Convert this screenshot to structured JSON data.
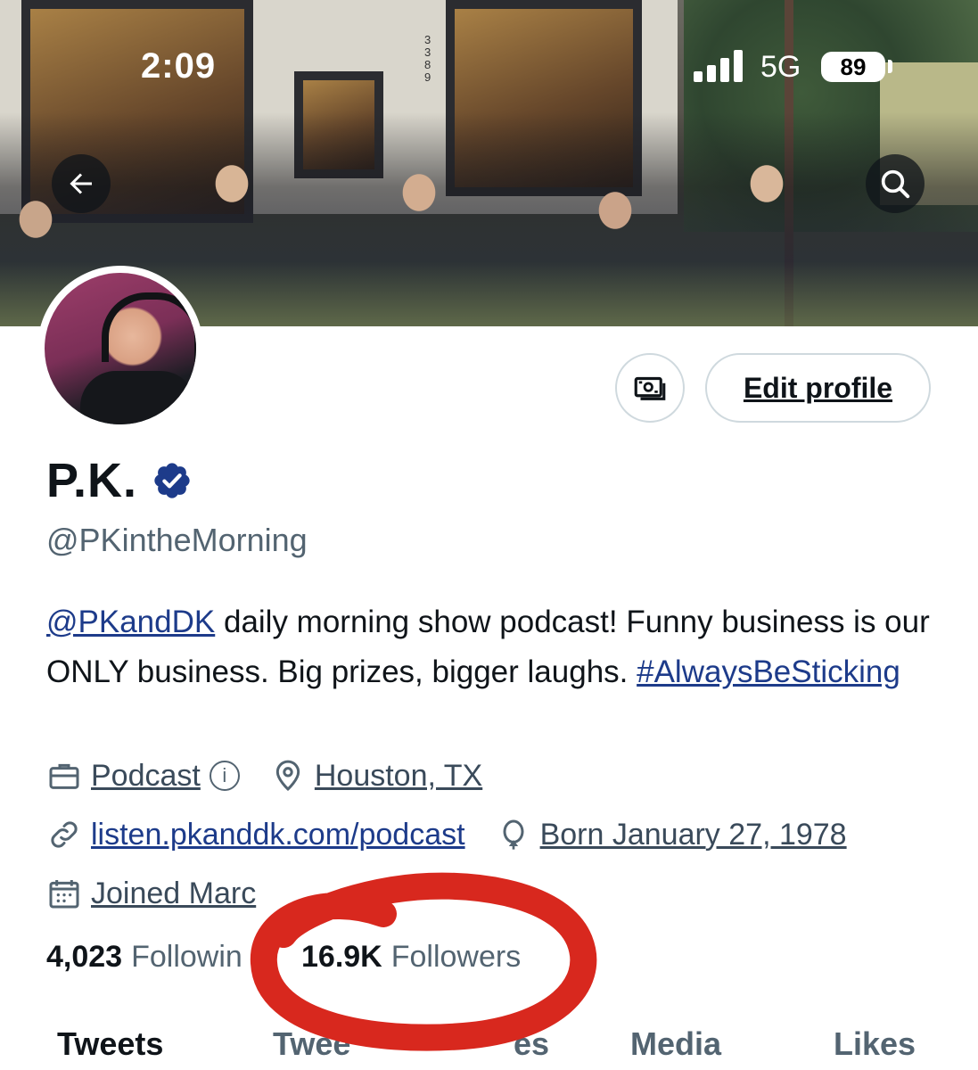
{
  "status_bar": {
    "time": "2:09",
    "network": "5G",
    "battery": "89"
  },
  "banner": {
    "building_number": "3389"
  },
  "profile": {
    "name": "P.K.",
    "handle": "@PKintheMorning",
    "edit_label": "Edit profile",
    "bio": {
      "mention": "@PKandDK",
      "text1": " daily morning show podcast! Funny business is our ONLY business. Big prizes, bigger laughs. ",
      "hashtag": "#AlwaysBeSticking"
    },
    "category": "Podcast",
    "category_info": "i",
    "location": "Houston, TX",
    "website": "listen.pkanddk.com/podcast",
    "birthday": "Born January 27, 1978",
    "joined": "Joined Marc"
  },
  "counts": {
    "following_value": "4,023",
    "following_label": "Followin",
    "followers_value": "16.9K",
    "followers_label": "Followers"
  },
  "tabs": {
    "tweets": "Tweets",
    "replies_left": "Twee",
    "replies_right": "es",
    "media": "Media",
    "likes": "Likes"
  },
  "colors": {
    "link": "#1d3b8a",
    "verified": "#1d3b8a",
    "annotation": "#d8281e",
    "secondary_text": "#536471"
  },
  "icons": [
    "back-arrow-icon",
    "search-icon",
    "tip-jar-icon",
    "verified-badge-icon",
    "briefcase-icon",
    "location-pin-icon",
    "link-icon",
    "balloon-icon",
    "calendar-icon"
  ]
}
